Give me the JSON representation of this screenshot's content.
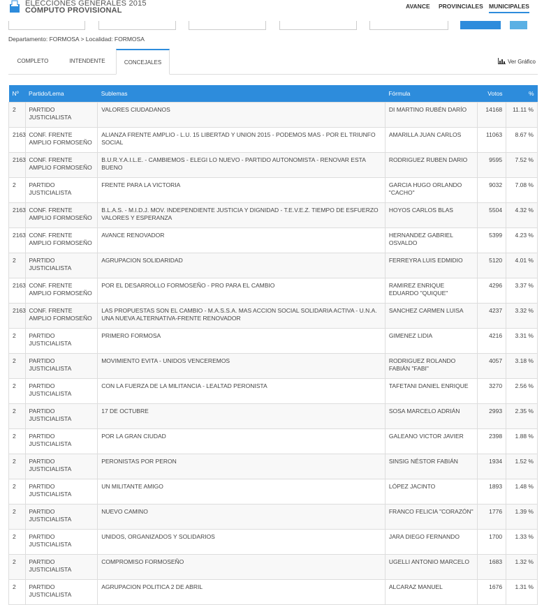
{
  "header": {
    "title_line1": "ELECCIONES GENERALES 2015",
    "title_line2": "CÓMPUTO PROVISIONAL",
    "nav": [
      "AVANCE",
      "PROVINCIALES",
      "MUNICIPALES"
    ],
    "accent_color": "#2d8cdc"
  },
  "breadcrumb": "Departamento: FORMOSA > Localidad: FORMOSA",
  "tabs": [
    "COMPLETO",
    "INTENDENTE",
    "CONCEJALES"
  ],
  "active_tab": "CONCEJALES",
  "ver_grafico": "Ver Gráfico",
  "table": {
    "headers": [
      "Nº",
      "Partido/Lema",
      "Sublemas",
      "Fórmula",
      "Votos",
      "%"
    ],
    "rows": [
      [
        "2",
        "PARTIDO JUSTICIALISTA",
        "VALORES CIUDADANOS",
        "DI MARTINO RUBÉN DARÍO",
        "14168",
        "11.11 %"
      ],
      [
        "2163",
        "CONF. FRENTE AMPLIO FORMOSEÑO",
        "ALIANZA FRENTE AMPLIO - L.U. 15 LIBERTAD Y UNION 2015 - PODEMOS MAS - POR EL TRIUNFO SOCIAL",
        "AMARILLA JUAN CARLOS",
        "11063",
        "8.67 %"
      ],
      [
        "2163",
        "CONF. FRENTE AMPLIO FORMOSEÑO",
        "B.U.R.Y.A.I.L.E. - CAMBIEMOS - ELEGI LO NUEVO - PARTIDO AUTONOMISTA - RENOVAR ESTA BUENO",
        "RODRIGUEZ RUBEN DARIO",
        "9595",
        "7.52 %"
      ],
      [
        "2",
        "PARTIDO JUSTICIALISTA",
        "FRENTE PARA LA VICTORIA",
        "GARCIA HUGO ORLANDO \"CACHO\"",
        "9032",
        "7.08 %"
      ],
      [
        "2163",
        "CONF. FRENTE AMPLIO FORMOSEÑO",
        "B.L.A.S. - M.I.D.J. MOV. INDEPENDIENTE JUSTICIA Y DIGNIDAD - T.E.V.E.Z. TIEMPO DE ESFUERZO VALORES Y ESPERANZA",
        "HOYOS CARLOS BLAS",
        "5504",
        "4.32 %"
      ],
      [
        "2163",
        "CONF. FRENTE AMPLIO FORMOSEÑO",
        "AVANCE RENOVADOR",
        "HERNANDEZ GABRIEL OSVALDO",
        "5399",
        "4.23 %"
      ],
      [
        "2",
        "PARTIDO JUSTICIALISTA",
        "AGRUPACION SOLIDARIDAD",
        "FERREYRA LUIS EDMIDIO",
        "5120",
        "4.01 %"
      ],
      [
        "2163",
        "CONF. FRENTE AMPLIO FORMOSEÑO",
        "POR EL DESARROLLO FORMOSEÑO - PRO PARA EL CAMBIO",
        "RAMIREZ ENRIQUE EDUARDO \"QUIQUE\"",
        "4296",
        "3.37 %"
      ],
      [
        "2163",
        "CONF. FRENTE AMPLIO FORMOSEÑO",
        "LAS PROPUESTAS SON EL CAMBIO - M.A.S.S.A. MAS ACCION SOCIAL SOLIDARIA ACTIVA - U.N.A. UNA NUEVA ALTERNATIVA-FRENTE RENOVADOR",
        "SANCHEZ CARMEN LUISA",
        "4237",
        "3.32 %"
      ],
      [
        "2",
        "PARTIDO JUSTICIALISTA",
        "PRIMERO FORMOSA",
        "GIMENEZ LIDIA",
        "4216",
        "3.31 %"
      ],
      [
        "2",
        "PARTIDO JUSTICIALISTA",
        "MOVIMIENTO EVITA - UNIDOS VENCEREMOS",
        "RODRIGUEZ ROLANDO FABIÁN \"FABI\"",
        "4057",
        "3.18 %"
      ],
      [
        "2",
        "PARTIDO JUSTICIALISTA",
        "CON LA FUERZA DE LA MILITANCIA - LEALTAD PERONISTA",
        "TAFETANI DANIEL ENRIQUE",
        "3270",
        "2.56 %"
      ],
      [
        "2",
        "PARTIDO JUSTICIALISTA",
        "17 DE OCTUBRE",
        "SOSA MARCELO ADRIÁN",
        "2993",
        "2.35 %"
      ],
      [
        "2",
        "PARTIDO JUSTICIALISTA",
        "POR LA GRAN CIUDAD",
        "GALEANO VICTOR JAVIER",
        "2398",
        "1.88 %"
      ],
      [
        "2",
        "PARTIDO JUSTICIALISTA",
        "PERONISTAS POR PERON",
        "SINSIG NÉSTOR FABIÁN",
        "1934",
        "1.52 %"
      ],
      [
        "2",
        "PARTIDO JUSTICIALISTA",
        "UN MILITANTE AMIGO",
        "LÓPEZ JACINTO",
        "1893",
        "1.48 %"
      ],
      [
        "2",
        "PARTIDO JUSTICIALISTA",
        "NUEVO CAMINO",
        "FRANCO FELICIA \"CORAZÓN\"",
        "1776",
        "1.39 %"
      ],
      [
        "2",
        "PARTIDO JUSTICIALISTA",
        "UNIDOS, ORGANIZADOS Y SOLIDARIOS",
        "JARA DIEGO FERNANDO",
        "1700",
        "1.33 %"
      ],
      [
        "2",
        "PARTIDO JUSTICIALISTA",
        "COMPROMISO FORMOSEÑO",
        "UGELLI ANTONIO MARCELO",
        "1683",
        "1.32 %"
      ],
      [
        "2",
        "PARTIDO JUSTICIALISTA",
        "AGRUPACION POLITICA 2 DE ABRIL",
        "ALCARAZ MANUEL",
        "1676",
        "1.31 %"
      ]
    ]
  }
}
